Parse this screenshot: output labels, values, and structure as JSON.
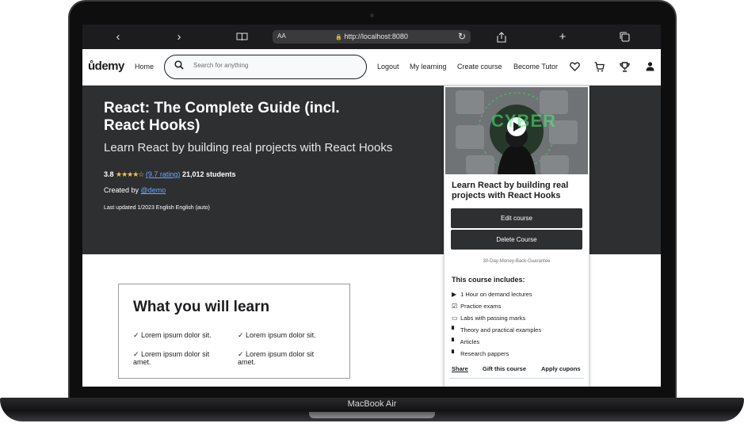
{
  "device": {
    "model_label": "MacBook Air"
  },
  "browser": {
    "back_icon": "chevron-left-icon",
    "forward_icon": "chevron-right-icon",
    "reader_label": "AA",
    "url": "http://localhost:8080",
    "lock_icon": "🔒",
    "reload_icon": "↻"
  },
  "header": {
    "logo": "ůdemy",
    "home": "Home",
    "search_placeholder": "Search for anything",
    "logout": "Logout",
    "my_learning": "My learning",
    "create_course": "Create course",
    "become_tutor": "Become Tutor",
    "icons": [
      "heart-icon",
      "cart-icon",
      "trophy-icon",
      "user-icon"
    ]
  },
  "course": {
    "title": "React: The Complete Guide (incl. React Hooks)",
    "subtitle": "Learn React by building real projects with React Hooks",
    "rating": "3.8",
    "stars": "★★★★☆",
    "rating_count": "(9.7 rating)",
    "students": "21,012 students",
    "created_by_label": "Created by",
    "author": "@demo",
    "last_updated": "Last updated 1/2023 English English (auto)"
  },
  "learn": {
    "heading": "What you will learn",
    "items": [
      "✓ Lorem ipsum dolor sit.",
      "✓ Lorem ipsum dolor sit.",
      "✓ Lorem ipsum dolor sit amet.",
      "✓ Lorem ipsum dolor sit amet."
    ]
  },
  "card": {
    "thumbnail_text": "CYBER",
    "title": "Learn React by building real projects with React Hooks",
    "edit_button": "Edit course",
    "delete_button": "Delete Course",
    "guarantee": "30-Day-Money-Back-Guarantee",
    "includes_title": "This course includes:",
    "features": [
      {
        "icon": "▶",
        "icon_name": "play-circle-icon",
        "label": "1 Hour on demand lectures"
      },
      {
        "icon": "☑",
        "icon_name": "checklist-icon",
        "label": "Practice exams"
      },
      {
        "icon": "▭",
        "icon_name": "calendar-icon",
        "label": "Labs with passing marks"
      },
      {
        "icon": "▘",
        "icon_name": "document-icon",
        "label": "Theory and practical examples"
      },
      {
        "icon": "▘",
        "icon_name": "article-icon",
        "label": "Articles"
      },
      {
        "icon": "▘",
        "icon_name": "paper-icon",
        "label": "Research pappers"
      }
    ],
    "share": "Share",
    "gift": "Gift this course",
    "coupons": "Apply cupons"
  },
  "colors": {
    "accent": "#a435f0",
    "dark_bg": "#2d2f31",
    "link": "#6ea8ff",
    "star": "#f4c150"
  }
}
